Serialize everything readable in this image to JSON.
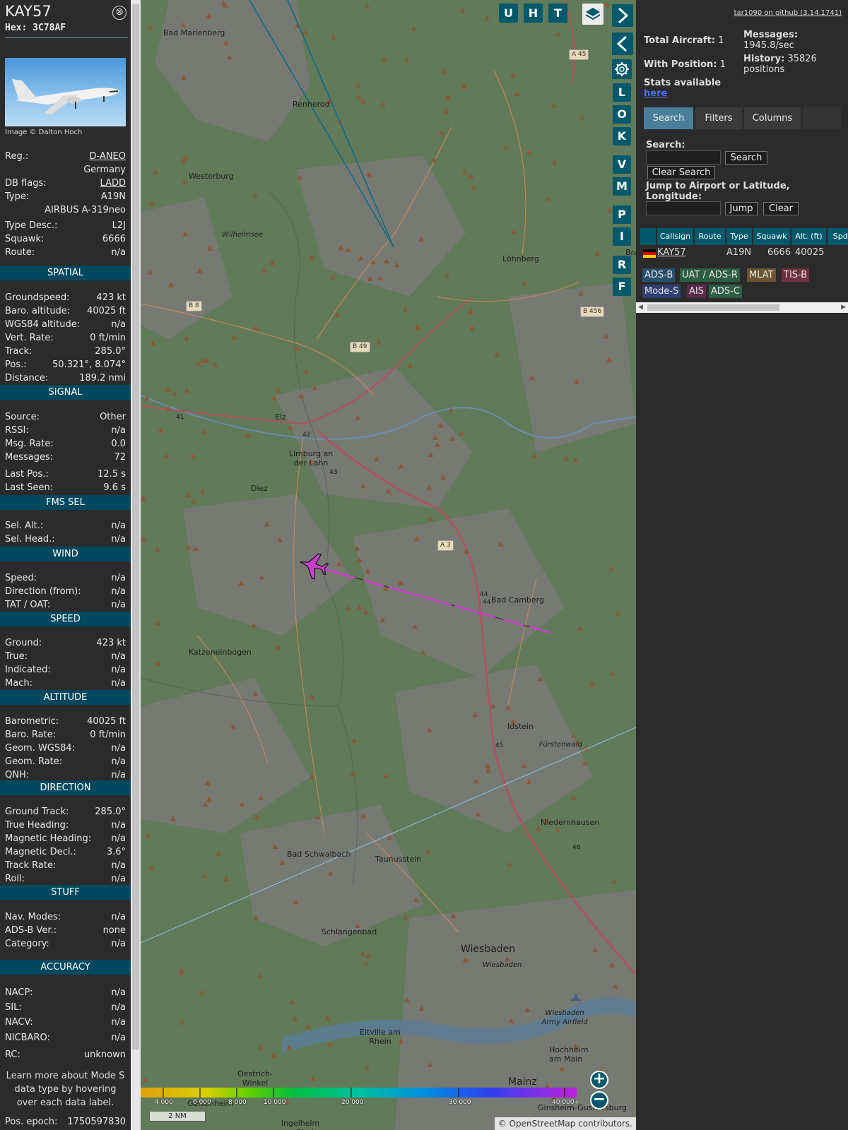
{
  "left": {
    "callsign": "KAY57",
    "hex": "Hex: 3C78AF",
    "close_icon": "⊗",
    "credit": "Image © Dalton Hoch",
    "top_rows": [
      {
        "k": "Reg.:",
        "v": "D-ANEO",
        "link": true
      },
      {
        "k": "",
        "v": "Germany"
      },
      {
        "k": "DB flags:",
        "v": "LADD",
        "link": true
      },
      {
        "k": "Type:",
        "v": "A19N"
      },
      {
        "k": "",
        "v": "AIRBUS A-319neo"
      },
      {
        "k": "Type Desc.:",
        "v": "L2J"
      },
      {
        "k": "Squawk:",
        "v": "6666"
      },
      {
        "k": "Route:",
        "v": "n/a"
      }
    ],
    "sections": [
      {
        "title": "SPATIAL",
        "rows": [
          {
            "k": "Groundspeed:",
            "v": "423 kt"
          },
          {
            "k": "Baro. altitude:",
            "v": "40025 ft"
          },
          {
            "k": "WGS84 altitude:",
            "v": "n/a"
          },
          {
            "k": "Vert. Rate:",
            "v": "0 ft/min"
          },
          {
            "k": "Track:",
            "v": "285.0°"
          },
          {
            "k": "Pos.:",
            "v": "50.321°, 8.074°"
          },
          {
            "k": "Distance:",
            "v": "189.2 nmi"
          }
        ]
      },
      {
        "title": "SIGNAL",
        "rows": [
          {
            "k": "Source:",
            "v": "Other"
          },
          {
            "k": "RSSI:",
            "v": "n/a"
          },
          {
            "k": "Msg. Rate:",
            "v": "0.0"
          },
          {
            "k": "Messages:",
            "v": "72"
          },
          {
            "k": "Last Pos.:",
            "v": "12.5 s"
          },
          {
            "k": "Last Seen:",
            "v": "9.6 s"
          }
        ]
      },
      {
        "title": "FMS SEL",
        "rows": [
          {
            "k": "Sel. Alt.:",
            "v": "n/a"
          },
          {
            "k": "Sel. Head.:",
            "v": "n/a"
          }
        ]
      },
      {
        "title": "WIND",
        "rows": [
          {
            "k": "Speed:",
            "v": "n/a"
          },
          {
            "k": "Direction (from):",
            "v": "n/a"
          },
          {
            "k": "TAT / OAT:",
            "v": "n/a"
          }
        ]
      },
      {
        "title": "SPEED",
        "rows": [
          {
            "k": "Ground:",
            "v": "423 kt"
          },
          {
            "k": "True:",
            "v": "n/a"
          },
          {
            "k": "Indicated:",
            "v": "n/a"
          },
          {
            "k": "Mach:",
            "v": "n/a"
          }
        ]
      },
      {
        "title": "ALTITUDE",
        "rows": [
          {
            "k": "Barometric:",
            "v": "40025 ft"
          },
          {
            "k": "Baro. Rate:",
            "v": "0 ft/min"
          },
          {
            "k": "Geom. WGS84:",
            "v": "n/a"
          },
          {
            "k": "Geom. Rate:",
            "v": "n/a"
          },
          {
            "k": "QNH:",
            "v": "n/a"
          }
        ]
      },
      {
        "title": "DIRECTION",
        "rows": [
          {
            "k": "Ground Track:",
            "v": "285.0°"
          },
          {
            "k": "True Heading:",
            "v": "n/a"
          },
          {
            "k": "Magnetic Heading:",
            "v": "n/a"
          },
          {
            "k": "Magnetic Decl.:",
            "v": "3.6°"
          },
          {
            "k": "Track Rate:",
            "v": "n/a"
          },
          {
            "k": "Roll:",
            "v": "n/a"
          }
        ]
      },
      {
        "title": "STUFF",
        "rows": [
          {
            "k": "Nav. Modes:",
            "v": "n/a"
          },
          {
            "k": "ADS-B Ver.:",
            "v": "none"
          },
          {
            "k": "Category:",
            "v": "n/a"
          }
        ]
      },
      {
        "title": "ACCURACY",
        "rows": [
          {
            "k": "NACP:",
            "v": "n/a"
          },
          {
            "k": "SIL:",
            "v": "n/a"
          },
          {
            "k": "NACV:",
            "v": "n/a"
          },
          {
            "k": "NICBARO:",
            "v": "n/a"
          },
          {
            "k": "RC:",
            "v": "unknown"
          }
        ]
      }
    ],
    "note": "Learn more about Mode S data type by hovering over each data label.",
    "epoch": {
      "k": "Pos. epoch:",
      "v": "1750597830"
    }
  },
  "map": {
    "towns": [
      "Bad Marienberg",
      "Rennerod",
      "Westerburg",
      "Wilhelmsee",
      "Löhnberg",
      "Elz",
      "Limburg an der Lahn",
      "Diez",
      "Bad Camberg",
      "Katzenelnbogen",
      "Idstein",
      "Fürstenwald",
      "Niedernhausen",
      "Bad Schwalbach",
      "Taunusstein",
      "Schlangenbad",
      "Wiesbaden",
      "Wiesbaden",
      "Wiesbaden Army Airfield",
      "Eltville am Rhein",
      "Oestrich-Winkel",
      "Hochheim am Main",
      "Mainz",
      "Geisenheim",
      "Ingelheim am Rhein",
      "Ginsheim-Gustavsburg",
      "Bra"
    ],
    "road_tags": [
      "A 45",
      "B 8",
      "B 49",
      "B 456",
      "A 3"
    ],
    "road_numbers": [
      "41",
      "42",
      "43",
      "44",
      "44",
      "45",
      "46"
    ],
    "buttons_top": [
      "U",
      "H",
      "T"
    ],
    "buttons_side": [
      "L",
      "O",
      "K",
      "V",
      "M",
      "P",
      "I",
      "R",
      "F"
    ],
    "layers_icon": "layers-icon",
    "alt_ticks": [
      "4 000",
      "6 000",
      "8 000",
      "10 000",
      "20 000",
      "30 000",
      "40 000+"
    ],
    "scale": "2 NM",
    "attribution": "© OpenStreetMap contributors.",
    "zoom_in": "+",
    "zoom_out": "−"
  },
  "right": {
    "github": "tar1090 on github (3.14.1741)",
    "total_label": "Total Aircraft:",
    "total": "1",
    "withpos_label": "With Position:",
    "withpos": "1",
    "stats_label": "Stats available",
    "stats_link": "here",
    "messages_label": "Messages:",
    "messages": "1945.8/sec",
    "history_label": "History:",
    "history": "35826 positions",
    "tabs": [
      "Search",
      "Filters",
      "Columns"
    ],
    "search_label": "Search:",
    "search_btn": "Search",
    "clear_search_btn": "Clear Search",
    "jump_label": "Jump to Airport or Latitude, Longitude:",
    "jump_btn": "Jump",
    "clear_btn": "Clear",
    "columns": [
      "",
      "Callsign",
      "Route",
      "Type",
      "Squawk",
      "Alt. (ft)",
      "Spd."
    ],
    "row": {
      "callsign": "KAY57",
      "route": "",
      "type": "A19N",
      "squawk": "6666",
      "alt": "40025",
      "spd": ""
    },
    "badges": [
      {
        "label": "ADS-B",
        "color": "#28506e"
      },
      {
        "label": "UAT / ADS-R",
        "color": "#2c5d45"
      },
      {
        "label": "MLAT",
        "color": "#6b5631"
      },
      {
        "label": "TIS-B",
        "color": "#6e2f3e"
      },
      {
        "label": "Mode-S",
        "color": "#2f3f74"
      },
      {
        "label": "AIS",
        "color": "#5a2a4a"
      },
      {
        "label": "ADS-C",
        "color": "#2c5d45"
      }
    ]
  }
}
